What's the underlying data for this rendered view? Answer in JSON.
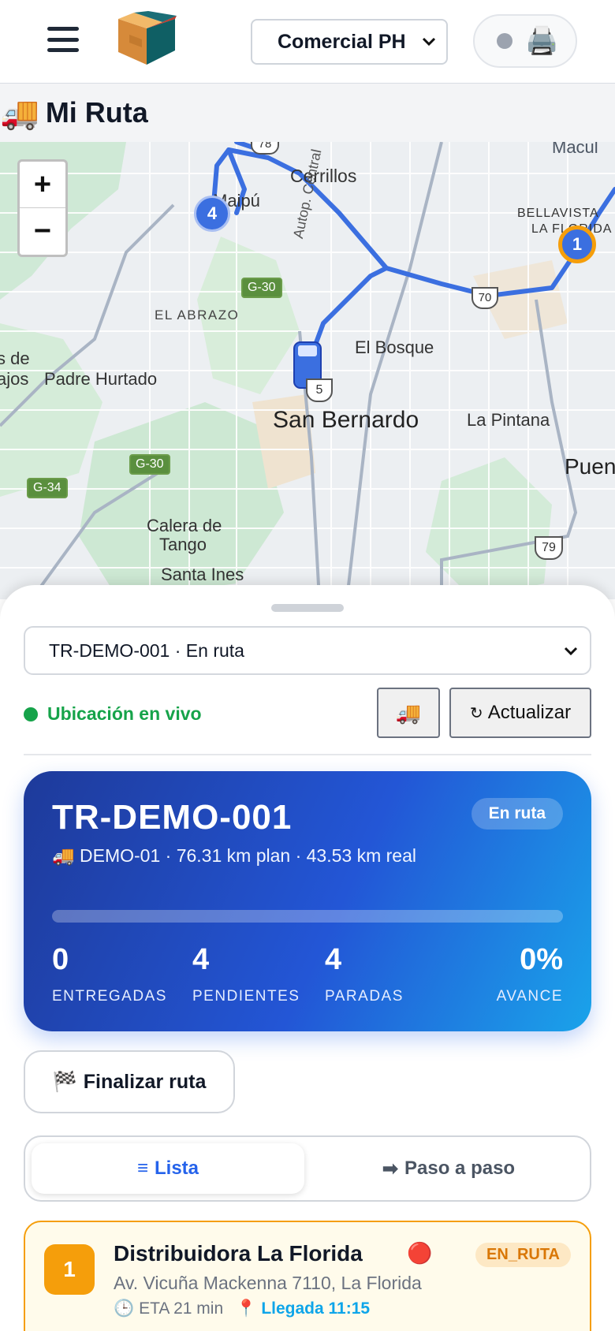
{
  "header": {
    "company": "Comercial PH"
  },
  "page": {
    "title": "Mi Ruta"
  },
  "map": {
    "labels": {
      "cerrillos": "Cerrillos",
      "el_abrazo": "EL ABRAZO",
      "el_bosque": "El Bosque",
      "padre_hurtado": "Padre Hurtado",
      "san_bernardo": "San Bernardo",
      "la_pintana": "La Pintana",
      "calera": "Calera de",
      "tango": "Tango",
      "santa_ines": "Santa Ines",
      "macul": "Macul",
      "bellavista": "BELLAVISTA",
      "la_florida": "LA FLORIDA",
      "puente": "Puen",
      "autop_central": "Autop. Central",
      "s_de": "s de",
      "ajos": "ajos",
      "maipu_frag": "Maipú"
    },
    "shields": {
      "g30a": "G-30",
      "g30b": "G-30",
      "g34": "G-34",
      "r70": "70",
      "r5": "5",
      "r79": "79",
      "r78": "78"
    },
    "markers": {
      "stop_1": "1",
      "stop_4": "4"
    },
    "zoom_in": "+",
    "zoom_out": "−"
  },
  "sheet": {
    "route_select": "TR-DEMO-001 · En ruta",
    "live_label": "Ubicación en vivo",
    "refresh_icon": "↻",
    "refresh_label": "Actualizar"
  },
  "card": {
    "code": "TR-DEMO-001",
    "status": "En ruta",
    "meta": "🚚 DEMO-01 · 76.31 km plan · 43.53 km real",
    "progress": 0,
    "stats": [
      {
        "value": "0",
        "label": "ENTREGADAS"
      },
      {
        "value": "4",
        "label": "PENDIENTES"
      },
      {
        "value": "4",
        "label": "PARADAS"
      },
      {
        "value": "0%",
        "label": "AVANCE"
      }
    ]
  },
  "finish_label": "Finalizar ruta",
  "tabs": {
    "list": "Lista",
    "step": "Paso a paso"
  },
  "stops": [
    {
      "number": "1",
      "name": "Distribuidora La Florida",
      "status": "EN_RUTA",
      "address": "Av. Vicuña Mackenna 7110, La Florida",
      "eta": "ETA 21 min",
      "arrival": "Llegada 11:15"
    }
  ],
  "colors": {
    "accent": "#2563eb",
    "live": "#16a34a",
    "stop_accent": "#f59e0b",
    "route_line": "#3b6fe0"
  }
}
